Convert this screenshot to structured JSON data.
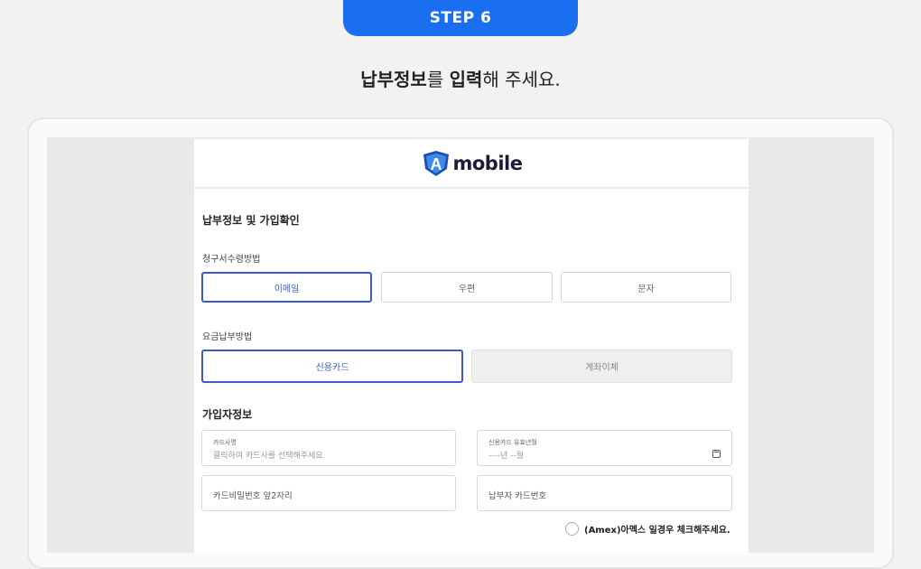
{
  "step_badge": "STEP 6",
  "headline": {
    "bold1": "납부정보",
    "part1": "를 ",
    "bold2": "입력",
    "part2": "해 주세요."
  },
  "logo": {
    "mark": "A",
    "text": "mobile"
  },
  "form": {
    "title": "납부정보 및 가입확인",
    "billing": {
      "label": "청구서수령방법",
      "options": [
        "이메일",
        "우편",
        "문자"
      ],
      "selected": "이메일"
    },
    "payment": {
      "label": "요금납부방법",
      "options": [
        "신용카드",
        "계좌이체"
      ],
      "selected": "신용카드"
    },
    "subscriber": {
      "title": "가입자정보",
      "card_company": {
        "label": "카드사명",
        "placeholder": "클릭하여 카드사를 선택해주세요"
      },
      "card_expiry": {
        "label": "신용카드 유효년월",
        "placeholder": "----년 --월"
      },
      "card_password": {
        "placeholder": "카드비밀번호 앞2자리"
      },
      "payer_card_number": {
        "placeholder": "납부자 카드번호"
      },
      "amex_text": "(Amex)아멕스 일경우 체크해주세요."
    }
  },
  "colors": {
    "accent": "#1a6ff0",
    "selected_border": "#3a5bc8"
  },
  "icons": {
    "calendar": "calendar-icon",
    "radio": "radio-icon"
  }
}
